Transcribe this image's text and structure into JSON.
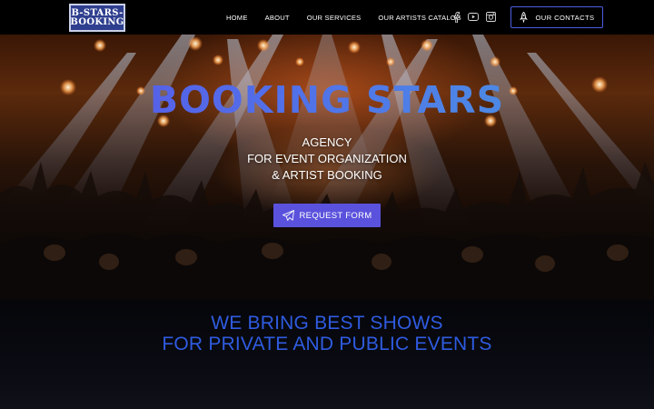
{
  "logo": {
    "line1": "B-STARS-",
    "line2": "BOOKING"
  },
  "nav": {
    "items": [
      {
        "label": "HOME"
      },
      {
        "label": "ABOUT"
      },
      {
        "label": "OUR SERVICES"
      },
      {
        "label": "OUR ARTISTS CATALOG"
      }
    ]
  },
  "socials": [
    {
      "icon": "facebook-icon"
    },
    {
      "icon": "youtube-icon"
    },
    {
      "icon": "instagram-icon"
    }
  ],
  "contact_button": {
    "label": "OUR CONTACTS",
    "icon": "rocket-icon"
  },
  "hero": {
    "title": "BOOKING STARS",
    "subtitle_line1": "AGENCY",
    "subtitle_line2": "FOR EVENT ORGANIZATION",
    "subtitle_line3": "& ARTIST BOOKING",
    "request_button": {
      "label": "REQUEST FORM",
      "icon": "paper-plane-icon"
    }
  },
  "band": {
    "line1": "WE BRING BEST SHOWS",
    "line2": "FOR PRIVATE AND PUBLIC EVENTS"
  },
  "colors": {
    "accent": "#5a52dc",
    "title_blue": "#4a66e6",
    "band_text": "#2f5be0",
    "logo_bg": "#2f3f8f"
  }
}
